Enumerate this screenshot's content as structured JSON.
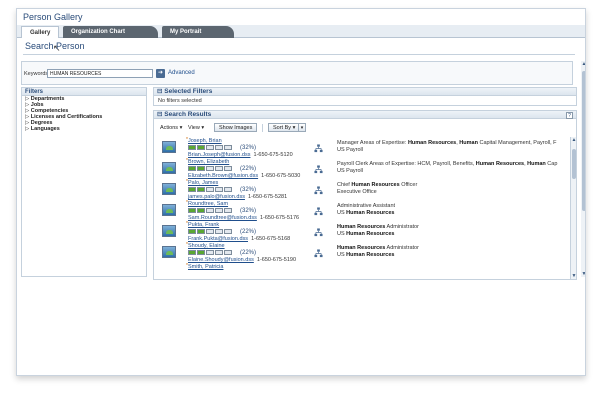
{
  "app": {
    "title": "Person Gallery"
  },
  "tabs": [
    {
      "label": "Gallery"
    },
    {
      "label": "Organization Chart"
    },
    {
      "label": "My Portrait"
    }
  ],
  "page": {
    "title": "Search Person"
  },
  "search": {
    "keywords_label": "Keywords",
    "keywords_value": "HUMAN RESOURCES",
    "go_icon": "arrow-right-icon",
    "advanced_label": "Advanced"
  },
  "filters": {
    "title": "Filters",
    "items": [
      {
        "label": "Departments"
      },
      {
        "label": "Jobs"
      },
      {
        "label": "Competencies"
      },
      {
        "label": "Licenses and Certifications"
      },
      {
        "label": "Degrees"
      },
      {
        "label": "Languages"
      }
    ]
  },
  "selected_filters": {
    "title": "Selected Filters",
    "empty_text": "No filters selected"
  },
  "results": {
    "title": "Search Results",
    "toolbar": {
      "actions": "Actions",
      "view": "View",
      "show_images": "Show Images",
      "sort_by": "Sort By"
    },
    "rows": [
      {
        "name": "Joseph, Brian",
        "pct": "(32%)",
        "level": 2,
        "email": "Brian.Joseph@fusion.dss",
        "phone": "1-650-675-5120",
        "line1_pre": "Manager    Areas of Expertise: ",
        "line1_b1": "Human Resources",
        "line1_mid": ", ",
        "line1_b2": "Human",
        "line1_post": " Capital Management, Payroll, F",
        "line2_pre": "US Payroll",
        "line2_b": ""
      },
      {
        "name": "Brown, Elizabeth",
        "pct": "(22%)",
        "level": 2,
        "email": "Elizabeth.Brown@fusion.dss",
        "phone": "1-650-675-5030",
        "line1_pre": "Payroll Clerk    Areas of Expertise: HCM, Payroll, Benefits, ",
        "line1_b1": "Human Resources",
        "line1_mid": ", ",
        "line1_b2": "Human",
        "line1_post": " Cap",
        "line2_pre": "US Payroll",
        "line2_b": ""
      },
      {
        "name": "Palo, James",
        "pct": "(32%)",
        "level": 2,
        "email": "james.palo@fusion.dss",
        "phone": "1-650-675-5281",
        "line1_pre": "Chief ",
        "line1_b1": "Human Resources",
        "line1_mid": " Officer",
        "line1_b2": "",
        "line1_post": "",
        "line2_pre": "Executive Office",
        "line2_b": ""
      },
      {
        "name": "Roundtree, Sam",
        "pct": "(32%)",
        "level": 2,
        "email": "Sam.Roundtree@fusion.dss",
        "phone": "1-650-675-5176",
        "line1_pre": "Administrative Assistant",
        "line1_b1": "",
        "line1_mid": "",
        "line1_b2": "",
        "line1_post": "",
        "line2_pre": "US ",
        "line2_b": "Human Resources"
      },
      {
        "name": "Pukta, Frank",
        "pct": "(22%)",
        "level": 2,
        "email": "Frank.Pukta@fusion.dss",
        "phone": "1-650-675-5168",
        "line1_pre": "",
        "line1_b1": "Human Resources",
        "line1_mid": " Administrator",
        "line1_b2": "",
        "line1_post": "",
        "line2_pre": "US ",
        "line2_b": "Human Resources"
      },
      {
        "name": "Shoudy, Elaine",
        "pct": "(22%)",
        "level": 2,
        "email": "Elaine.Shoudy@fusion.dss",
        "phone": "1-650-675-5190",
        "line1_pre": "",
        "line1_b1": "Human Resources",
        "line1_mid": " Administrator",
        "line1_b2": "",
        "line1_post": "",
        "line2_pre": "US ",
        "line2_b": "Human Resources"
      },
      {
        "name": "Smith, Patricia",
        "pct": "",
        "level": 0,
        "email": "",
        "phone": "",
        "line1_pre": "",
        "line1_b1": "",
        "line1_mid": "",
        "line1_b2": "",
        "line1_post": "",
        "line2_pre": "",
        "line2_b": ""
      }
    ]
  },
  "colors": {
    "accent": "#2a4c7a",
    "bar_filled": "#5aa832",
    "bar_empty": "#e3e8ee",
    "link": "#1f4e8c"
  }
}
